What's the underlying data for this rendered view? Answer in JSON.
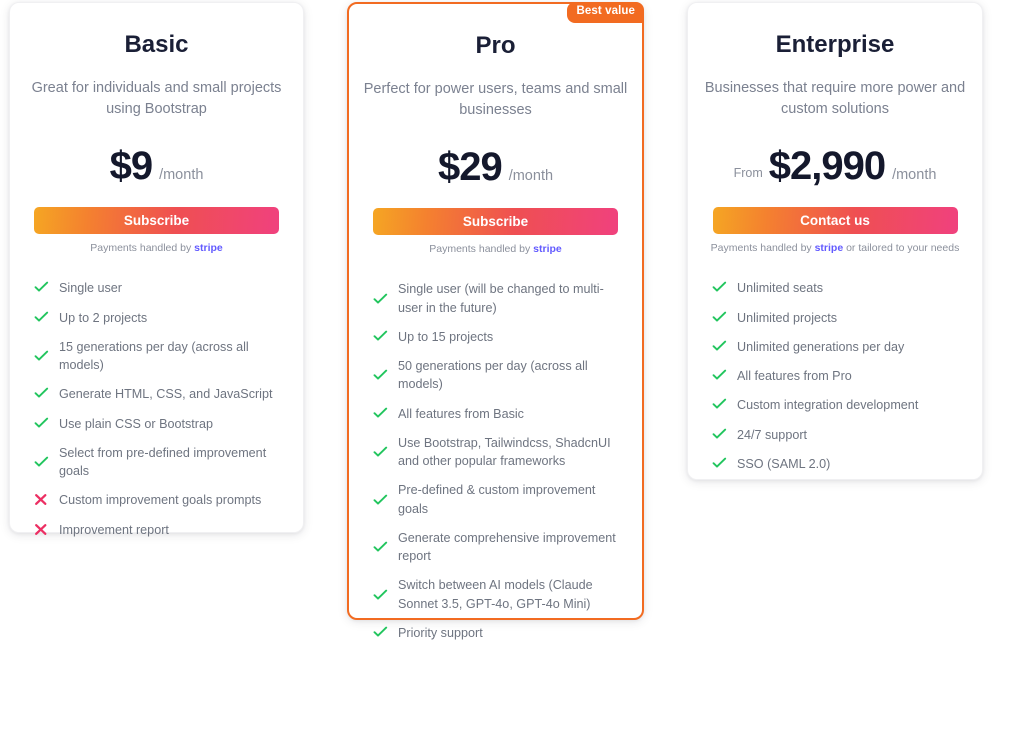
{
  "theme": {
    "accent_orange": "#f26b21",
    "gradient_start": "#f5a623",
    "gradient_end": "#f0417e",
    "check_green": "#22c55e",
    "cross_pink": "#ec2f63",
    "stripe_purple": "#635bff",
    "price_color": "#14182c",
    "muted_text": "#7b8190",
    "page_background": "#ffffff"
  },
  "plans": [
    {
      "id": "basic",
      "name": "Basic",
      "description": "Great for individuals and small projects using Bootstrap",
      "price_prefix": "",
      "price": "$9",
      "period": "/month",
      "cta_label": "Subscribe",
      "payment_note_before": "Payments handled by",
      "payment_provider": "stripe",
      "payment_note_after": "",
      "badge": "",
      "features": [
        {
          "included": true,
          "text": "Single user"
        },
        {
          "included": true,
          "text": "Up to 2 projects"
        },
        {
          "included": true,
          "text": "15 generations per day (across all models)"
        },
        {
          "included": true,
          "text": "Generate HTML, CSS, and JavaScript"
        },
        {
          "included": true,
          "text": "Use plain CSS or Bootstrap"
        },
        {
          "included": true,
          "text": "Select from pre-defined improvement goals"
        },
        {
          "included": false,
          "text": "Custom improvement goals prompts"
        },
        {
          "included": false,
          "text": "Improvement report"
        }
      ]
    },
    {
      "id": "pro",
      "name": "Pro",
      "description": "Perfect for power users, teams and small businesses",
      "price_prefix": "",
      "price": "$29",
      "period": "/month",
      "cta_label": "Subscribe",
      "payment_note_before": "Payments handled by",
      "payment_provider": "stripe",
      "payment_note_after": "",
      "badge": "Best value",
      "features": [
        {
          "included": true,
          "text": "Single user (will be changed to multi-user in the future)"
        },
        {
          "included": true,
          "text": "Up to 15 projects"
        },
        {
          "included": true,
          "text": "50 generations per day (across all models)"
        },
        {
          "included": true,
          "text": "All features from Basic"
        },
        {
          "included": true,
          "text": "Use Bootstrap, Tailwindcss, ShadcnUI and other popular frameworks"
        },
        {
          "included": true,
          "text": "Pre-defined & custom improvement goals"
        },
        {
          "included": true,
          "text": "Generate comprehensive improvement report"
        },
        {
          "included": true,
          "text": "Switch between AI models (Claude Sonnet 3.5, GPT-4o, GPT-4o Mini)"
        },
        {
          "included": true,
          "text": "Priority support"
        }
      ]
    },
    {
      "id": "enterprise",
      "name": "Enterprise",
      "description": "Businesses that require more power and custom solutions",
      "price_prefix": "From",
      "price": "$2,990",
      "period": "/month",
      "cta_label": "Contact us",
      "payment_note_before": "Payments handled by",
      "payment_provider": "stripe",
      "payment_note_after": "or tailored to your needs",
      "badge": "",
      "features": [
        {
          "included": true,
          "text": "Unlimited seats"
        },
        {
          "included": true,
          "text": "Unlimited projects"
        },
        {
          "included": true,
          "text": "Unlimited generations per day"
        },
        {
          "included": true,
          "text": "All features from Pro"
        },
        {
          "included": true,
          "text": "Custom integration development"
        },
        {
          "included": true,
          "text": "24/7 support"
        },
        {
          "included": true,
          "text": "SSO (SAML 2.0)"
        }
      ]
    }
  ]
}
